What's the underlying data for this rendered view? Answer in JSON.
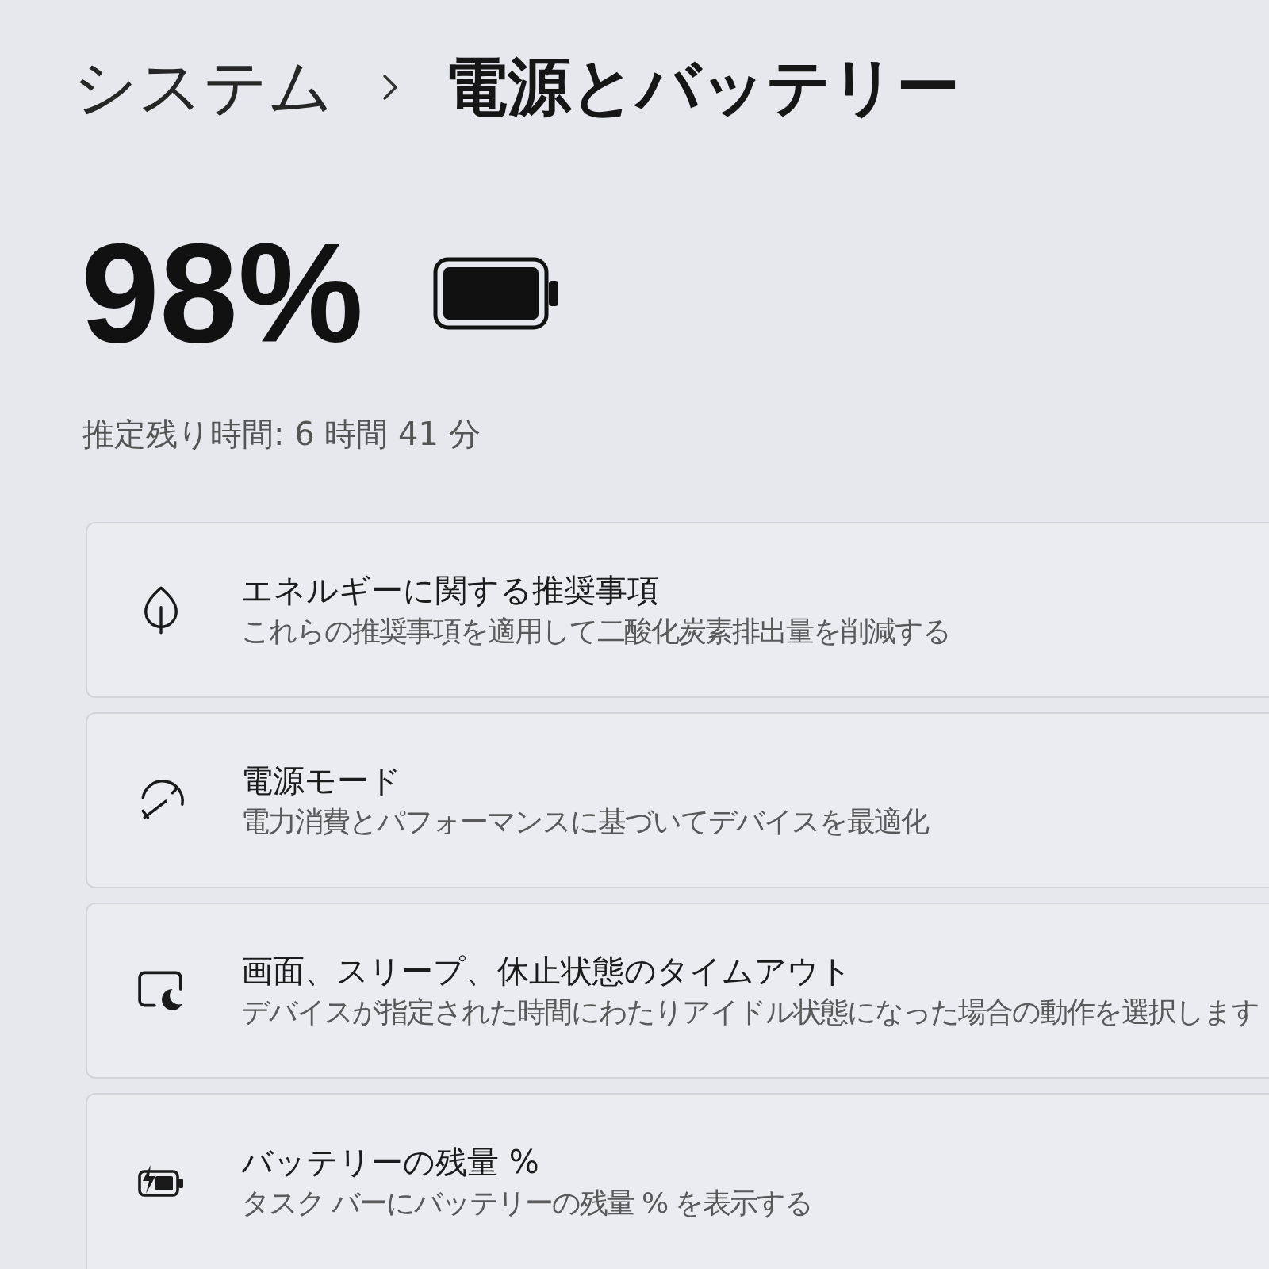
{
  "breadcrumb": {
    "parent": "システム",
    "current": "電源とバッテリー"
  },
  "battery": {
    "percent": "98%",
    "estimate": "推定残り時間: 6 時間 41 分"
  },
  "settings": [
    {
      "title": "エネルギーに関する推奨事項",
      "description": "これらの推奨事項を適用して二酸化炭素排出量を削減する"
    },
    {
      "title": "電源モード",
      "description": "電力消費とパフォーマンスに基づいてデバイスを最適化"
    },
    {
      "title": "画面、スリープ、休止状態のタイムアウト",
      "description": "デバイスが指定された時間にわたりアイドル状態になった場合の動作を選択します"
    },
    {
      "title": "バッテリーの残量 %",
      "description": "タスク バーにバッテリーの残量 % を表示する"
    }
  ]
}
